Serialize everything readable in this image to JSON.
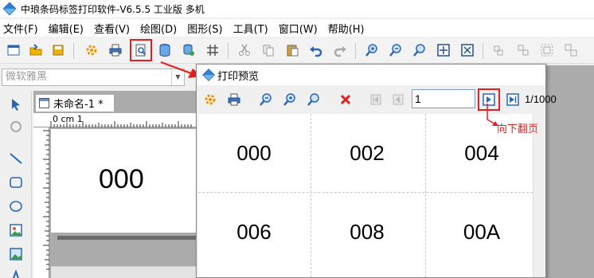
{
  "window": {
    "title": "中琅条码标签打印软件-V6.5.5 工业版 多机"
  },
  "menu": [
    {
      "label": "文件(F)"
    },
    {
      "label": "编辑(E)"
    },
    {
      "label": "查看(V)"
    },
    {
      "label": "绘图(D)"
    },
    {
      "label": "图形(S)"
    },
    {
      "label": "工具(T)"
    },
    {
      "label": "窗口(W)"
    },
    {
      "label": "帮助(H)"
    }
  ],
  "fontbar": {
    "font_name": "微软雅黑"
  },
  "document": {
    "tab_label": "未命名-1 *",
    "ruler_label": "0 cm 1",
    "canvas_text": "000"
  },
  "dialog": {
    "title": "打印预览",
    "page_input": "1",
    "page_count": "1/1000",
    "cells": [
      "000",
      "002",
      "004",
      "006",
      "008",
      "00A"
    ]
  },
  "annotation": {
    "label": "向下翻页",
    "color": "#e02020"
  }
}
